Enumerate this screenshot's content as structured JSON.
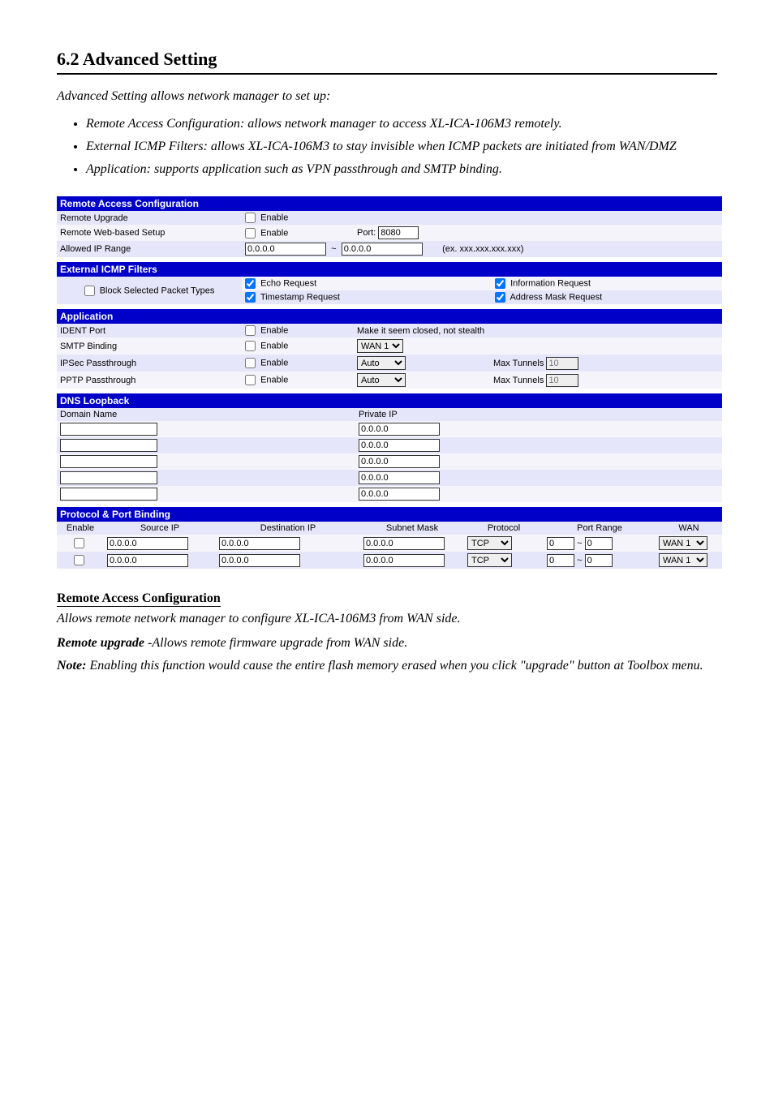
{
  "body_text": {
    "heading": "6.2   Advanced Setting",
    "intro": "Advanced Setting allows network manager to set up:",
    "bullets": [
      "Remote Access Configuration: allows network manager to access XL-ICA-106M3 remotely.",
      "External ICMP Filters: allows XL-ICA-106M3 to stay invisible when ICMP packets are initiated from WAN/DMZ",
      "Application: supports application such as VPN passthrough and SMTP binding."
    ],
    "desc_title": "Remote Access Configuration",
    "desc_body": "Allows remote network manager to configure XL-ICA-106M3 from WAN side.",
    "remote_upgrade_label": "Remote upgrade",
    "remote_upgrade_body": "-Allows remote firmware upgrade from WAN side.",
    "note_label": "Note:",
    "note_body": "Enabling this function would cause the entire flash memory erased when you click \"upgrade\" button at Toolbox menu."
  },
  "remote_access": {
    "section_title": "Remote Access Configuration",
    "rows": [
      {
        "label": "Remote Upgrade",
        "enable_label": "Enable"
      },
      {
        "label": "Remote Web-based Setup",
        "enable_label": "Enable",
        "port_label": "Port:",
        "port_value": "8080"
      },
      {
        "label": "Allowed IP Range",
        "from": "0.0.0.0",
        "to": "0.0.0.0",
        "tilde": "~",
        "hint": "(ex. xxx.xxx.xxx.xxx)"
      }
    ]
  },
  "icmp": {
    "section_title": "External ICMP Filters",
    "block_label": "Block Selected Packet Types",
    "items": [
      "Echo Request",
      "Information Request",
      "Timestamp Request",
      "Address Mask Request"
    ]
  },
  "application": {
    "section_title": "Application",
    "ident": {
      "label": "IDENT Port",
      "enable_label": "Enable",
      "hint": "Make it seem closed, not stealth"
    },
    "smtp": {
      "label": "SMTP Binding",
      "enable_label": "Enable",
      "select": "WAN 1"
    },
    "ipsec": {
      "label": "IPSec Passthrough",
      "enable_label": "Enable",
      "select": "Auto",
      "max_label": "Max Tunnels",
      "max_value": "10"
    },
    "pptp": {
      "label": "PPTP Passthrough",
      "enable_label": "Enable",
      "select": "Auto",
      "max_label": "Max Tunnels",
      "max_value": "10"
    }
  },
  "dns": {
    "section_title": "DNS Loopback",
    "col1": "Domain Name",
    "col2": "Private IP",
    "rows": [
      {
        "domain": "",
        "ip": "0.0.0.0"
      },
      {
        "domain": "",
        "ip": "0.0.0.0"
      },
      {
        "domain": "",
        "ip": "0.0.0.0"
      },
      {
        "domain": "",
        "ip": "0.0.0.0"
      },
      {
        "domain": "",
        "ip": "0.0.0.0"
      }
    ]
  },
  "binding": {
    "section_title": "Protocol & Port Binding",
    "headers": [
      "Enable",
      "Source IP",
      "Destination IP",
      "Subnet Mask",
      "Protocol",
      "Port Range",
      "WAN"
    ],
    "tilde": "~",
    "rows": [
      {
        "src": "0.0.0.0",
        "dst": "0.0.0.0",
        "mask": "0.0.0.0",
        "proto": "TCP",
        "p_from": "0",
        "p_to": "0",
        "wan": "WAN 1"
      },
      {
        "src": "0.0.0.0",
        "dst": "0.0.0.0",
        "mask": "0.0.0.0",
        "proto": "TCP",
        "p_from": "0",
        "p_to": "0",
        "wan": "WAN 1"
      }
    ]
  }
}
